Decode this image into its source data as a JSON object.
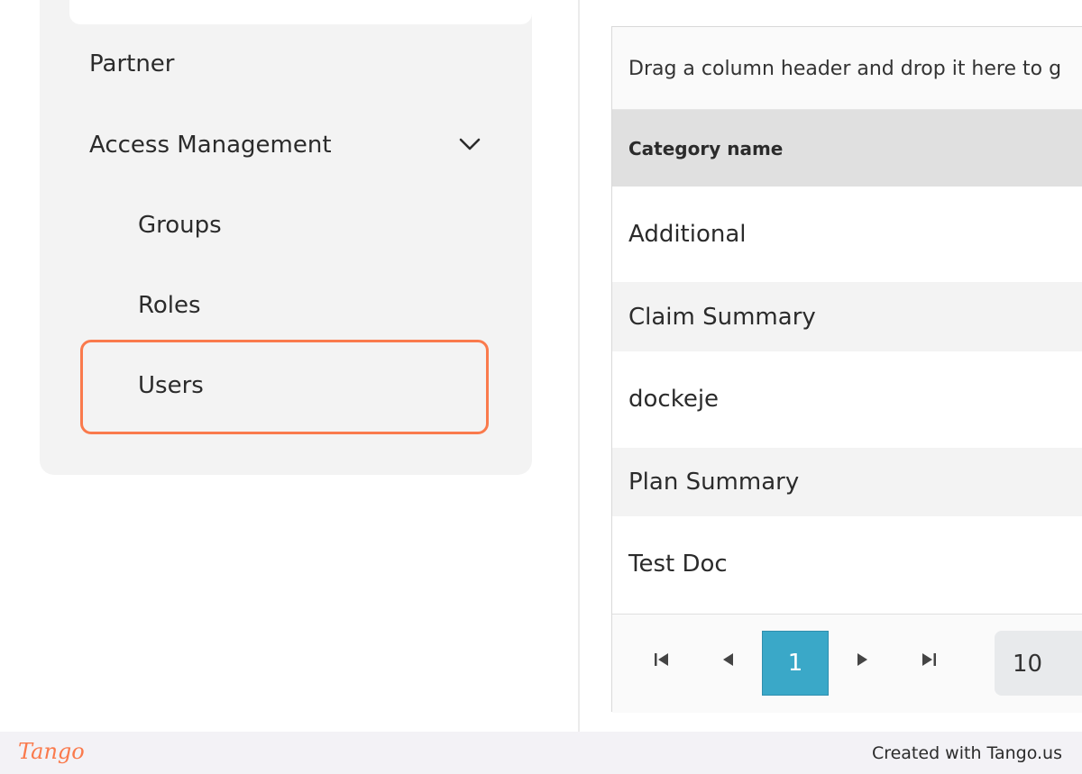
{
  "sidebar": {
    "items": [
      {
        "label": "Partner"
      },
      {
        "label": "Access Management",
        "icon": "chevron-down-icon",
        "expanded": true
      },
      {
        "label": "Groups"
      },
      {
        "label": "Roles"
      },
      {
        "label": "Users",
        "highlighted": true
      }
    ]
  },
  "grid": {
    "group_panel_text": "Drag a column header and drop it here to g",
    "column_header": "Category name",
    "rows": [
      "Additional",
      "Claim Summary",
      "dockeje",
      "Plan Summary",
      "Test Doc"
    ],
    "pager": {
      "icons": [
        "first-page-icon",
        "previous-page-icon",
        "next-page-icon",
        "last-page-icon"
      ],
      "current_page": "1",
      "page_size": "10"
    }
  },
  "footer": {
    "logo": "Tango",
    "text": "Created with Tango.us"
  },
  "colors": {
    "highlight": "#fa7a4c",
    "active_page": "#3aa8c8",
    "sidebar_bg": "#f3f3f3"
  }
}
